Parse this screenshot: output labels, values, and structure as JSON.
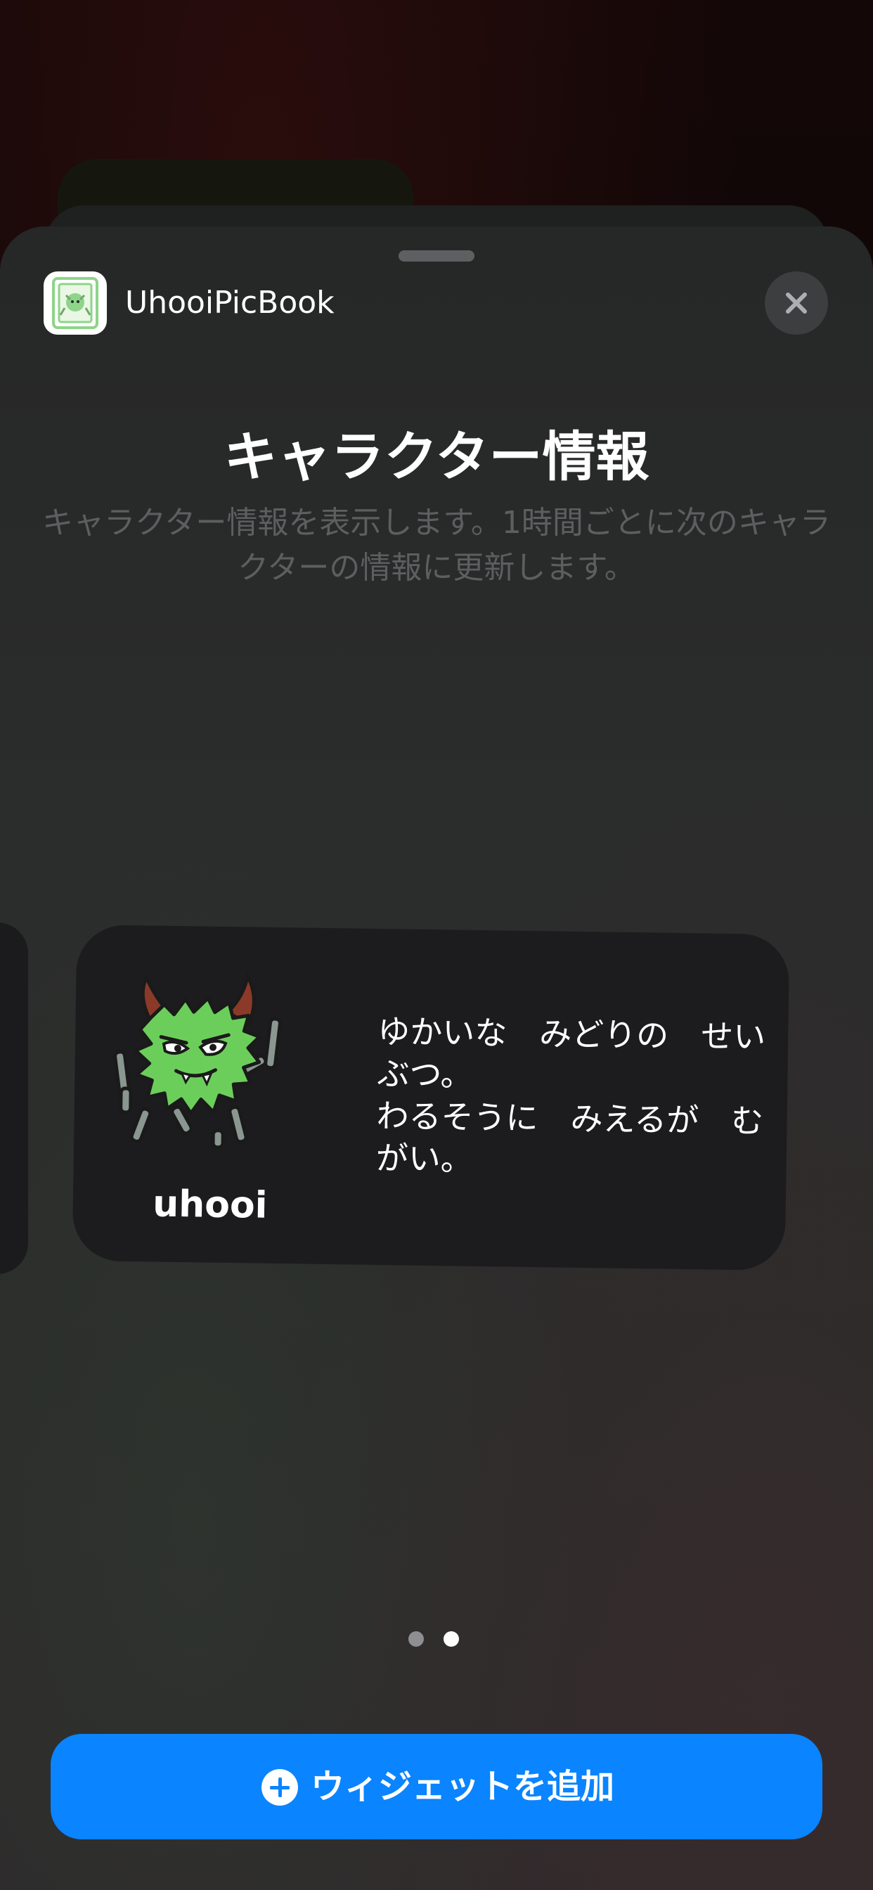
{
  "header": {
    "app_name": "UhooiPicBook",
    "app_icon": "uhooi-app-icon",
    "close_icon": "close-icon"
  },
  "widget_info": {
    "title": "キャラクター情報",
    "description": "キャラクター情報を表示します。1時間ごとに次のキャラクターの情報に更新します。"
  },
  "widget_preview": {
    "character_name": "uhooi",
    "character_description": "ゆかいな　みどりの　せいぶつ。\nわるそうに　みえるが　むがい。",
    "character_image": "uhooi-monster"
  },
  "pagination": {
    "total": 2,
    "current": 2
  },
  "add_button": {
    "label": "ウィジェットを追加",
    "icon": "plus-circle-icon"
  },
  "colors": {
    "accent": "#0a84ff",
    "sheet_background": "#2a2b2b",
    "widget_background": "#1c1c1e",
    "secondary_text": "#5d5e60",
    "monster_green": "#6cce5a"
  }
}
